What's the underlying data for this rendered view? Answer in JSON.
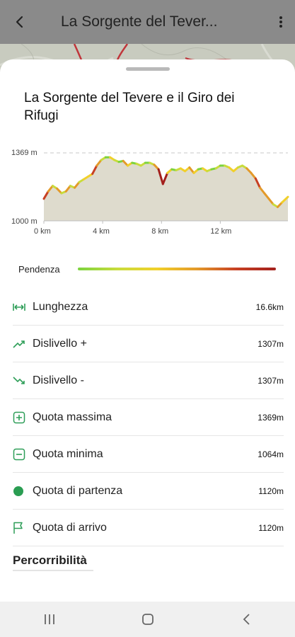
{
  "appbar": {
    "title": "La Sorgente del Tever..."
  },
  "route": {
    "title": "La Sorgente del Tevere e il Giro dei Rifugi"
  },
  "chart_data": {
    "type": "line",
    "title": "",
    "xlabel": "",
    "ylabel": "",
    "x_ticks": [
      "0 km",
      "4 km",
      "8 km",
      "12 km"
    ],
    "y_ticks": [
      "1369 m",
      "1000 m"
    ],
    "xlim": [
      0,
      16.6
    ],
    "ylim": [
      1000,
      1369
    ],
    "max_line": 1369,
    "series": [
      {
        "x": [
          0,
          0.3,
          0.6,
          0.9,
          1.2,
          1.5,
          1.8,
          2.1,
          2.4,
          2.7,
          3.0,
          3.3,
          3.6,
          3.9,
          4.2,
          4.5,
          4.8,
          5.1,
          5.4,
          5.7,
          6.0,
          6.3,
          6.6,
          6.9,
          7.2,
          7.5,
          7.8,
          8.1,
          8.4,
          8.7,
          9.0,
          9.3,
          9.6,
          9.9,
          10.2,
          10.5,
          10.8,
          11.1,
          11.4,
          11.7,
          12.0,
          12.3,
          12.6,
          12.9,
          13.2,
          13.5,
          13.8,
          14.1,
          14.4,
          14.7,
          15.0,
          15.3,
          15.6,
          15.9,
          16.2,
          16.6
        ],
        "y": [
          1120,
          1160,
          1190,
          1175,
          1150,
          1160,
          1190,
          1180,
          1210,
          1225,
          1240,
          1255,
          1300,
          1330,
          1345,
          1345,
          1330,
          1320,
          1325,
          1300,
          1315,
          1310,
          1300,
          1315,
          1315,
          1305,
          1280,
          1200,
          1260,
          1280,
          1275,
          1285,
          1270,
          1290,
          1260,
          1280,
          1285,
          1270,
          1280,
          1285,
          1300,
          1300,
          1290,
          1270,
          1290,
          1300,
          1285,
          1260,
          1230,
          1180,
          1150,
          1120,
          1090,
          1075,
          1100,
          1130
        ]
      }
    ]
  },
  "gradient": {
    "label": "Pendenza"
  },
  "stats": [
    {
      "icon": "length-icon",
      "name": "Lunghezza",
      "value": "16.6km"
    },
    {
      "icon": "ascent-icon",
      "name": "Dislivello +",
      "value": "1307m"
    },
    {
      "icon": "descent-icon",
      "name": "Dislivello -",
      "value": "1307m"
    },
    {
      "icon": "max-elevation-icon",
      "name": "Quota massima",
      "value": "1369m"
    },
    {
      "icon": "min-elevation-icon",
      "name": "Quota minima",
      "value": "1064m"
    },
    {
      "icon": "start-point-icon",
      "name": "Quota di partenza",
      "value": "1120m"
    },
    {
      "icon": "finish-flag-icon",
      "name": "Quota di arrivo",
      "value": "1120m"
    }
  ],
  "section": {
    "title": "Percorribilità"
  },
  "colors": {
    "accent_green": "#3aa65a",
    "appbar_bg": "#8a8a8a",
    "map_bg": "#c6c9bd",
    "route_red": "#c0353b"
  }
}
